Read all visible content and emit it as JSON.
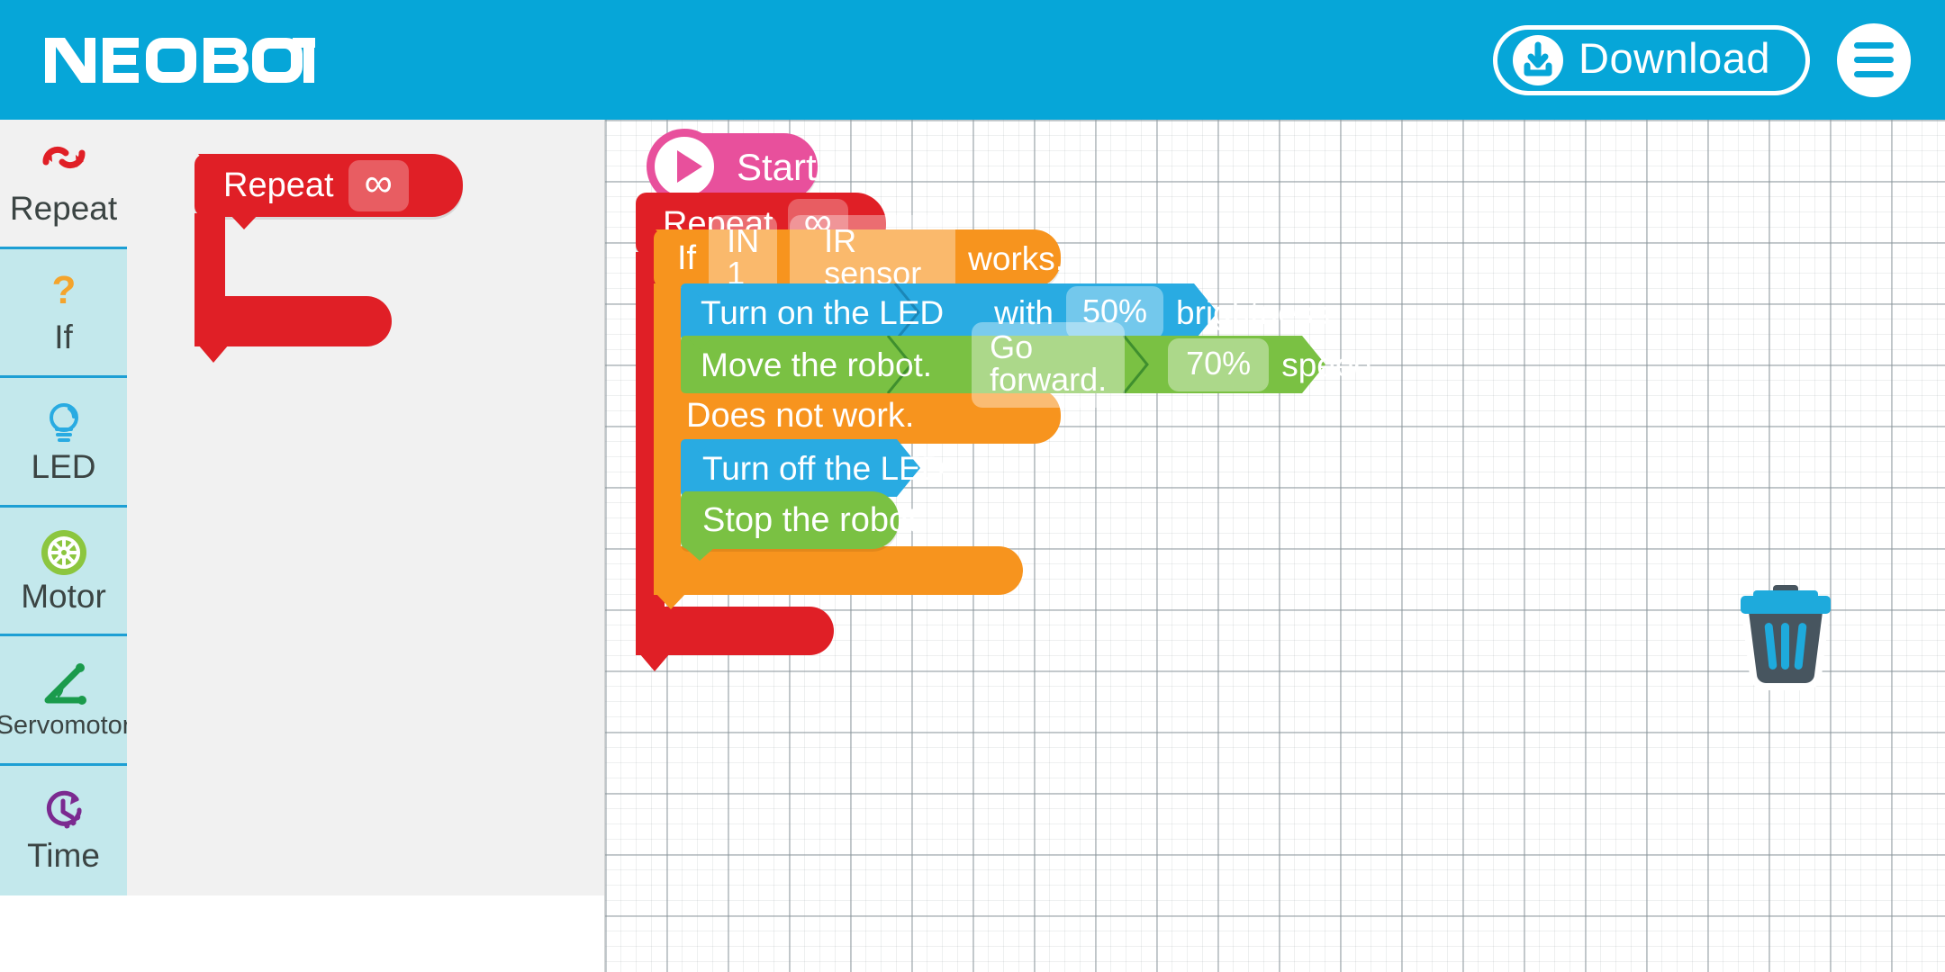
{
  "header": {
    "brand": "NEOBOT",
    "download_label": "Download",
    "download_icon": "download-circle-icon",
    "menu_icon": "hamburger-menu-icon",
    "bg_color": "#06a6d8"
  },
  "sidebar": {
    "items": [
      {
        "label": "Repeat",
        "icon": "repeat-loop-icon",
        "color": "#e01f26",
        "active": true
      },
      {
        "label": "If",
        "icon": "question-mark-icon",
        "color": "#f7941e",
        "active": false
      },
      {
        "label": "LED",
        "icon": "light-bulb-icon",
        "color": "#29abe2",
        "active": false
      },
      {
        "label": "Motor",
        "icon": "wheel-icon",
        "color": "#8cc63f",
        "active": false
      },
      {
        "label": "Servomotor",
        "icon": "angle-icon",
        "color": "#1a9b4c",
        "active": false
      },
      {
        "label": "Time",
        "icon": "clock-icon",
        "color": "#7b2a90",
        "active": false
      }
    ]
  },
  "palette": {
    "blocks": [
      {
        "type": "repeat",
        "label": "Repeat",
        "value": "∞",
        "color": "#e01f26"
      }
    ]
  },
  "canvas": {
    "trash_icon": "trash-can-icon",
    "script": {
      "start": {
        "label": "Start",
        "icon": "play-icon",
        "color": "#e8509c"
      },
      "repeat": {
        "label": "Repeat",
        "value": "∞",
        "color": "#e01f26"
      },
      "if": {
        "keyword": "If",
        "port": "IN 1",
        "sensor": "IR sensor",
        "suffix": "works.",
        "else_label": "Does not work.",
        "color": "#f7941e"
      },
      "then_blocks": [
        {
          "name": "led-on",
          "color": "#29abe2",
          "segments": [
            "Turn on the LED",
            "with",
            "50%",
            "brightness"
          ],
          "action": "Turn on the LED",
          "with_word": "with",
          "value": "50%",
          "unit": "brightness"
        },
        {
          "name": "motor-move",
          "color": "#7ac143",
          "action": "Move the robot.",
          "direction": "Go forward.",
          "value": "70%",
          "unit": "speed"
        }
      ],
      "else_blocks": [
        {
          "name": "led-off",
          "color": "#29abe2",
          "action": "Turn off the LED"
        },
        {
          "name": "motor-stop",
          "color": "#7ac143",
          "action": "Stop the robot."
        }
      ]
    }
  }
}
